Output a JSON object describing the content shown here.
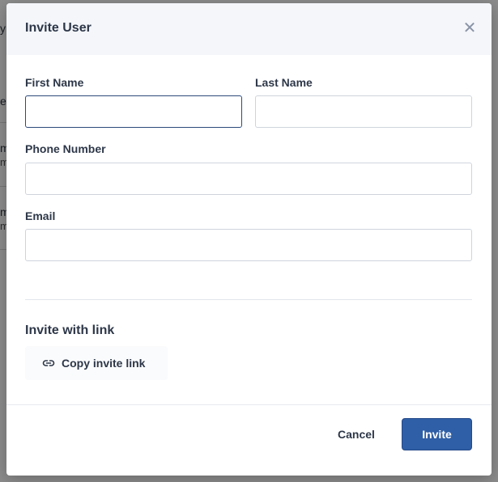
{
  "background": {
    "fragments": [
      {
        "text": "y",
        "kind": "main"
      },
      {
        "text": "e",
        "kind": "main"
      },
      {
        "text": "m",
        "kind": "main"
      },
      {
        "text": "m",
        "kind": "sub"
      },
      {
        "text": "m",
        "kind": "main"
      },
      {
        "text": "m",
        "kind": "sub"
      }
    ]
  },
  "modal": {
    "title": "Invite User",
    "close_icon": "close-icon",
    "fields": {
      "first_name": {
        "label": "First Name",
        "value": "",
        "placeholder": ""
      },
      "last_name": {
        "label": "Last Name",
        "value": "",
        "placeholder": ""
      },
      "phone_number": {
        "label": "Phone Number",
        "value": "",
        "placeholder": ""
      },
      "email": {
        "label": "Email",
        "value": "",
        "placeholder": ""
      }
    },
    "invite_link": {
      "section_title": "Invite with link",
      "button_label": "Copy invite link",
      "icon": "link-icon"
    },
    "footer": {
      "cancel_label": "Cancel",
      "invite_label": "Invite"
    }
  },
  "colors": {
    "primary": "#2f5fa6",
    "focus_border": "#2c4a7a",
    "header_bg": "#f4f6fa",
    "text": "#2d3748"
  }
}
